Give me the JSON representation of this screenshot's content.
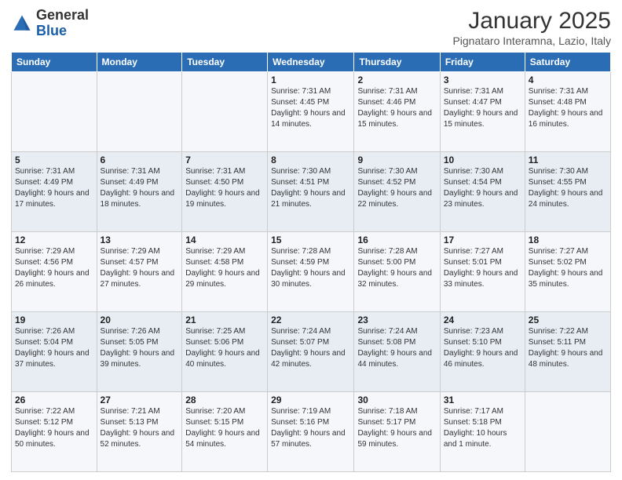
{
  "header": {
    "logo_general": "General",
    "logo_blue": "Blue",
    "month_title": "January 2025",
    "subtitle": "Pignataro Interamna, Lazio, Italy"
  },
  "days_of_week": [
    "Sunday",
    "Monday",
    "Tuesday",
    "Wednesday",
    "Thursday",
    "Friday",
    "Saturday"
  ],
  "weeks": [
    [
      {
        "day": "",
        "info": ""
      },
      {
        "day": "",
        "info": ""
      },
      {
        "day": "",
        "info": ""
      },
      {
        "day": "1",
        "info": "Sunrise: 7:31 AM\nSunset: 4:45 PM\nDaylight: 9 hours\nand 14 minutes."
      },
      {
        "day": "2",
        "info": "Sunrise: 7:31 AM\nSunset: 4:46 PM\nDaylight: 9 hours\nand 15 minutes."
      },
      {
        "day": "3",
        "info": "Sunrise: 7:31 AM\nSunset: 4:47 PM\nDaylight: 9 hours\nand 15 minutes."
      },
      {
        "day": "4",
        "info": "Sunrise: 7:31 AM\nSunset: 4:48 PM\nDaylight: 9 hours\nand 16 minutes."
      }
    ],
    [
      {
        "day": "5",
        "info": "Sunrise: 7:31 AM\nSunset: 4:49 PM\nDaylight: 9 hours\nand 17 minutes."
      },
      {
        "day": "6",
        "info": "Sunrise: 7:31 AM\nSunset: 4:49 PM\nDaylight: 9 hours\nand 18 minutes."
      },
      {
        "day": "7",
        "info": "Sunrise: 7:31 AM\nSunset: 4:50 PM\nDaylight: 9 hours\nand 19 minutes."
      },
      {
        "day": "8",
        "info": "Sunrise: 7:30 AM\nSunset: 4:51 PM\nDaylight: 9 hours\nand 21 minutes."
      },
      {
        "day": "9",
        "info": "Sunrise: 7:30 AM\nSunset: 4:52 PM\nDaylight: 9 hours\nand 22 minutes."
      },
      {
        "day": "10",
        "info": "Sunrise: 7:30 AM\nSunset: 4:54 PM\nDaylight: 9 hours\nand 23 minutes."
      },
      {
        "day": "11",
        "info": "Sunrise: 7:30 AM\nSunset: 4:55 PM\nDaylight: 9 hours\nand 24 minutes."
      }
    ],
    [
      {
        "day": "12",
        "info": "Sunrise: 7:29 AM\nSunset: 4:56 PM\nDaylight: 9 hours\nand 26 minutes."
      },
      {
        "day": "13",
        "info": "Sunrise: 7:29 AM\nSunset: 4:57 PM\nDaylight: 9 hours\nand 27 minutes."
      },
      {
        "day": "14",
        "info": "Sunrise: 7:29 AM\nSunset: 4:58 PM\nDaylight: 9 hours\nand 29 minutes."
      },
      {
        "day": "15",
        "info": "Sunrise: 7:28 AM\nSunset: 4:59 PM\nDaylight: 9 hours\nand 30 minutes."
      },
      {
        "day": "16",
        "info": "Sunrise: 7:28 AM\nSunset: 5:00 PM\nDaylight: 9 hours\nand 32 minutes."
      },
      {
        "day": "17",
        "info": "Sunrise: 7:27 AM\nSunset: 5:01 PM\nDaylight: 9 hours\nand 33 minutes."
      },
      {
        "day": "18",
        "info": "Sunrise: 7:27 AM\nSunset: 5:02 PM\nDaylight: 9 hours\nand 35 minutes."
      }
    ],
    [
      {
        "day": "19",
        "info": "Sunrise: 7:26 AM\nSunset: 5:04 PM\nDaylight: 9 hours\nand 37 minutes."
      },
      {
        "day": "20",
        "info": "Sunrise: 7:26 AM\nSunset: 5:05 PM\nDaylight: 9 hours\nand 39 minutes."
      },
      {
        "day": "21",
        "info": "Sunrise: 7:25 AM\nSunset: 5:06 PM\nDaylight: 9 hours\nand 40 minutes."
      },
      {
        "day": "22",
        "info": "Sunrise: 7:24 AM\nSunset: 5:07 PM\nDaylight: 9 hours\nand 42 minutes."
      },
      {
        "day": "23",
        "info": "Sunrise: 7:24 AM\nSunset: 5:08 PM\nDaylight: 9 hours\nand 44 minutes."
      },
      {
        "day": "24",
        "info": "Sunrise: 7:23 AM\nSunset: 5:10 PM\nDaylight: 9 hours\nand 46 minutes."
      },
      {
        "day": "25",
        "info": "Sunrise: 7:22 AM\nSunset: 5:11 PM\nDaylight: 9 hours\nand 48 minutes."
      }
    ],
    [
      {
        "day": "26",
        "info": "Sunrise: 7:22 AM\nSunset: 5:12 PM\nDaylight: 9 hours\nand 50 minutes."
      },
      {
        "day": "27",
        "info": "Sunrise: 7:21 AM\nSunset: 5:13 PM\nDaylight: 9 hours\nand 52 minutes."
      },
      {
        "day": "28",
        "info": "Sunrise: 7:20 AM\nSunset: 5:15 PM\nDaylight: 9 hours\nand 54 minutes."
      },
      {
        "day": "29",
        "info": "Sunrise: 7:19 AM\nSunset: 5:16 PM\nDaylight: 9 hours\nand 57 minutes."
      },
      {
        "day": "30",
        "info": "Sunrise: 7:18 AM\nSunset: 5:17 PM\nDaylight: 9 hours\nand 59 minutes."
      },
      {
        "day": "31",
        "info": "Sunrise: 7:17 AM\nSunset: 5:18 PM\nDaylight: 10 hours\nand 1 minute."
      },
      {
        "day": "",
        "info": ""
      }
    ]
  ]
}
